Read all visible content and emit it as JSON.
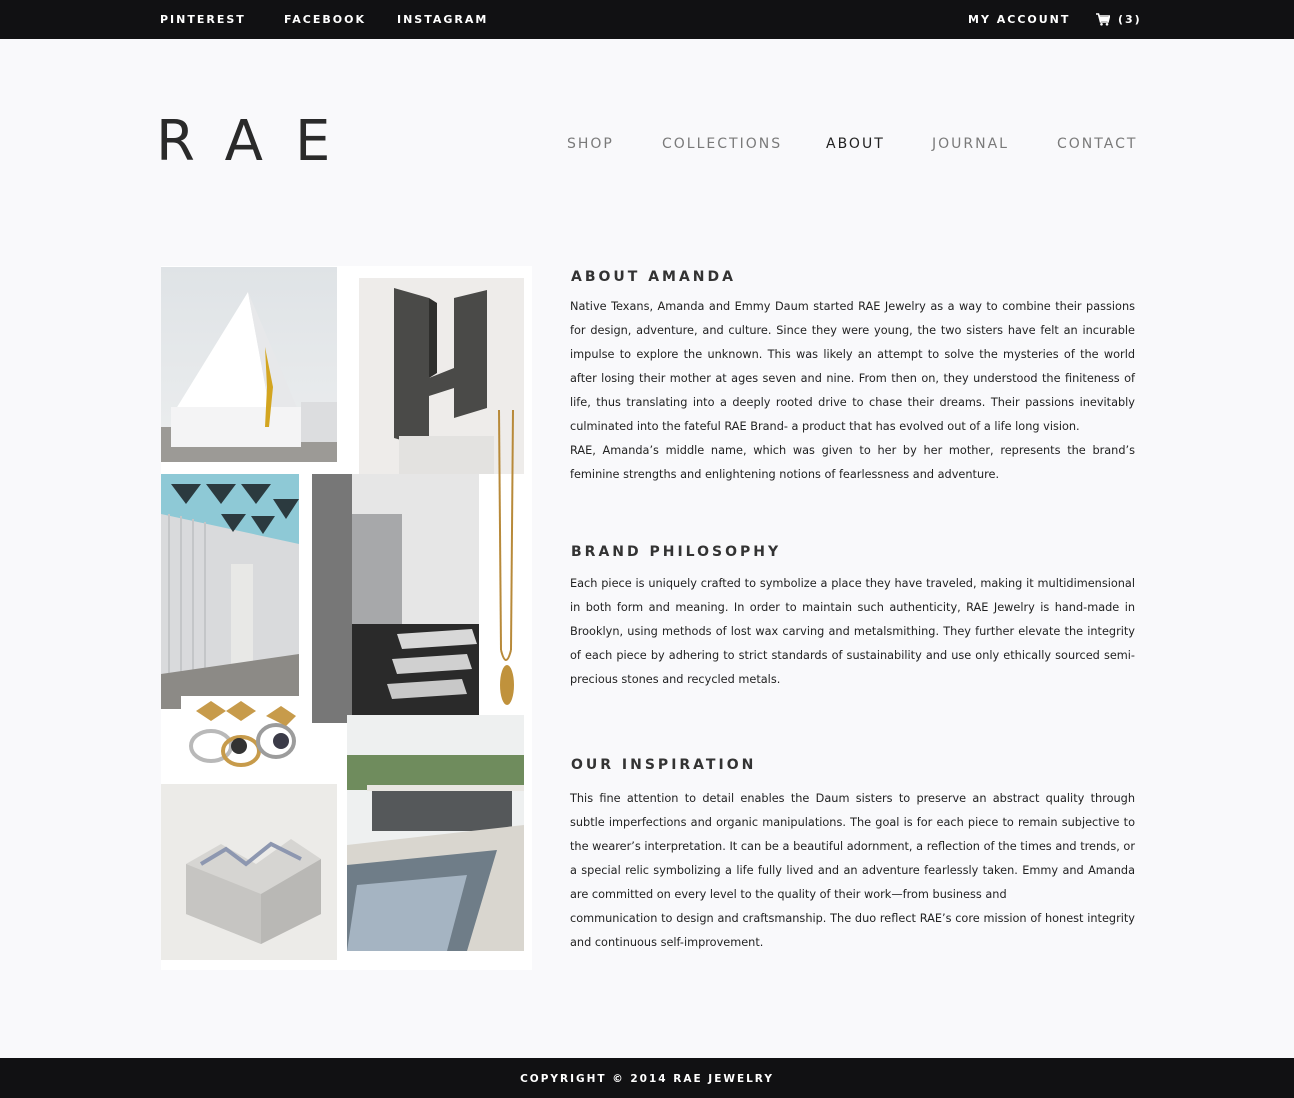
{
  "topbar": {
    "social": [
      "PINTEREST",
      "FACEBOOK",
      "INSTAGRAM"
    ],
    "account_label": "MY ACCOUNT",
    "cart_count": "(3)",
    "cart_icon": "cart-icon"
  },
  "header": {
    "logo": "RAE",
    "nav": [
      "SHOP",
      "COLLECTIONS",
      "ABOUT",
      "JOURNAL",
      "CONTACT"
    ],
    "active_nav": "ABOUT"
  },
  "about": {
    "title": "ABOUT AMANDA",
    "paragraphs": [
      "Native Texans, Amanda and Emmy Daum started RAE Jewelry as a way to combine their passions for design, adventure, and culture. Since they were young, the two sisters have felt an incurable impulse to explore the unknown. This was likely an attempt to solve the mysteries of the world after losing their mother at ages seven and nine. From then on, they understood the finiteness of life, thus translating into a deeply rooted drive to chase their dreams. Their passions inevitably culminated into the fateful RAE Brand- a product that has evolved out of a life long vision.",
      "RAE, Amanda’s middle name, which was given to her by her mother, represents the brand’s feminine strengths and enlightening notions of fearlessness and adventure."
    ]
  },
  "philosophy": {
    "title": "BRAND PHILOSOPHY",
    "paragraphs": [
      "Each piece is uniquely crafted to symbolize a place they have traveled, making it multidimensional in both form and meaning. In order to maintain such authenticity, RAE Jewelry is hand-made in Brooklyn, using methods of lost wax carving and metalsmithing. They further elevate the integrity of each piece by adhering to strict standards of sustainability and use only ethically sourced semi-precious stones and recycled metals."
    ]
  },
  "inspiration": {
    "title": "OUR INSPIRATION",
    "paragraphs": [
      "This fine attention to detail enables the Daum sisters to preserve an abstract quality through subtle imperfections and organic manipulations. The goal is for each piece to remain subjective to the wearer’s interpretation. It can be a beautiful adornment, a reflection of the times and trends, or a special relic symbolizing a life fully lived and an adventure fearlessly taken. Emmy and Amanda are committed on every level to the quality of their work—from business and",
      "communication to design and craftsmanship. The duo reflect RAE’s core mission of honest integrity and continuous self-improvement."
    ]
  },
  "footer": {
    "copyright": "COPYRIGHT © 2014 RAE JEWELRY"
  },
  "colors": {
    "bar": "#111113",
    "background": "#f9f9fb",
    "nav_inactive": "#7a7a7a",
    "accent_gold": "#c9a227"
  }
}
